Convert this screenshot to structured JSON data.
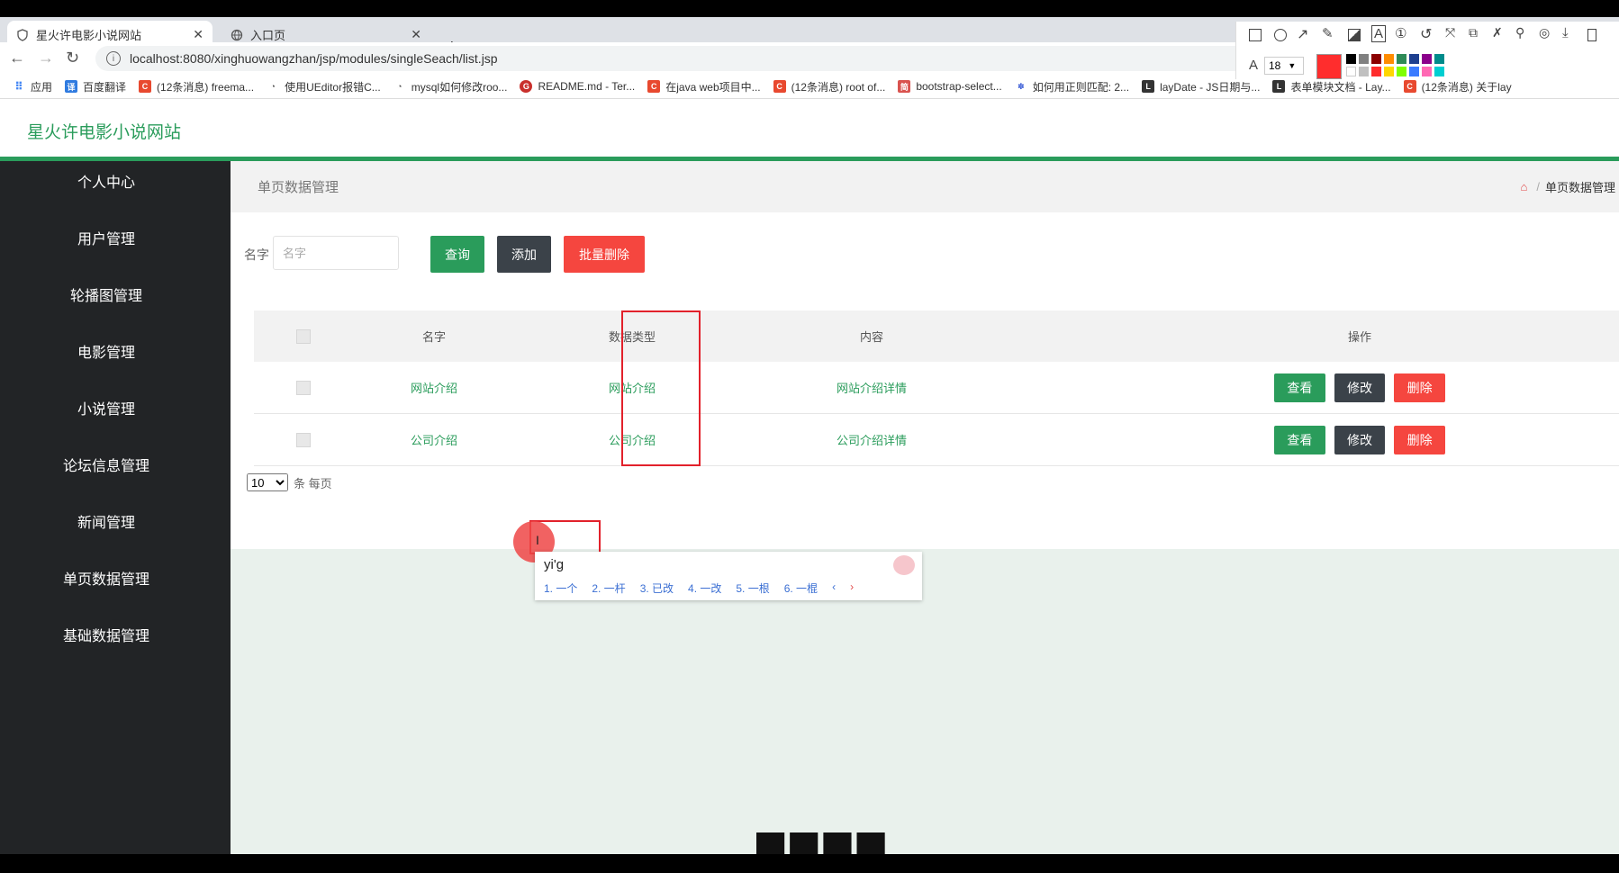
{
  "browser": {
    "tabs": [
      {
        "title": "星火许电影小说网站",
        "active": true
      },
      {
        "title": "入口页",
        "active": false
      }
    ],
    "url": "localhost:8080/xinghuowangzhan/jsp/modules/singleSeach/list.jsp",
    "bookmarks": [
      "应用",
      "百度翻译",
      "(12条消息) freema...",
      "使用UEditor报错C...",
      "mysql如何修改roo...",
      "README.md - Ter...",
      "在java web项目中...",
      "(12条消息) root of...",
      "bootstrap-select...",
      "如何用正则匹配: 2...",
      "layDate - JS日期与...",
      "表单模块文档 - Lay...",
      "(12条消息) 关于lay"
    ],
    "screenshot_tool": {
      "font_size": "18",
      "accent_color": "#ff2d2d"
    }
  },
  "app": {
    "site_title": "星火许电影小说网站",
    "sidebar": [
      "个人中心",
      "用户管理",
      "轮播图管理",
      "电影管理",
      "小说管理",
      "论坛信息管理",
      "新闻管理",
      "单页数据管理",
      "基础数据管理"
    ],
    "breadcrumb": {
      "title": "单页数据管理",
      "current": "单页数据管理"
    },
    "search": {
      "label": "名字",
      "placeholder": "名字"
    },
    "buttons": {
      "query": "查询",
      "add": "添加",
      "batch_delete": "批量删除"
    },
    "table": {
      "headers": [
        "名字",
        "数据类型",
        "内容",
        "操作"
      ],
      "rows": [
        {
          "name": "网站介绍",
          "type": "网站介绍",
          "content": "网站介绍详情"
        },
        {
          "name": "公司介绍",
          "type": "公司介绍",
          "content": "公司介绍详情"
        }
      ],
      "actions": {
        "view": "查看",
        "edit": "修改",
        "delete": "删除"
      }
    },
    "pager": {
      "page_size": "10",
      "per_page_label": "条 每页"
    }
  },
  "ime": {
    "composition": "yi'g",
    "candidates": [
      "1. 一个",
      "2. 一杆",
      "3. 已改",
      "4. 一改",
      "5. 一根",
      "6. 一棍"
    ]
  },
  "colors": {
    "brand_green": "#2a9c5b",
    "sidebar_bg": "#222426",
    "danger": "#f5463f",
    "dark_button": "#3b4249"
  }
}
